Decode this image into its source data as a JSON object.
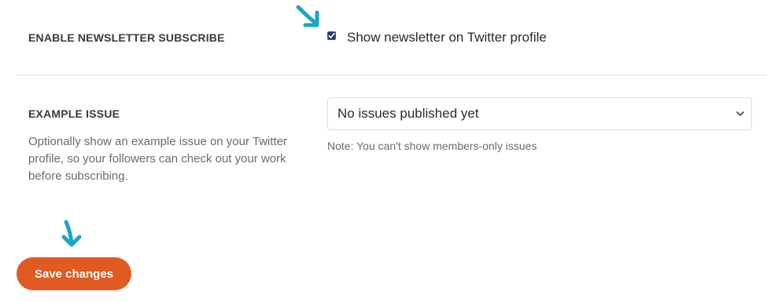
{
  "newsletter": {
    "label": "ENABLE NEWSLETTER SUBSCRIBE",
    "checkbox_label": "Show newsletter on Twitter profile",
    "checked": true
  },
  "example_issue": {
    "label": "EXAMPLE ISSUE",
    "help": "Optionally show an example issue on your Twitter profile, so your followers can check out your work before subscribing.",
    "selected": "No issues published yet",
    "note": "Note: You can't show members-only issues"
  },
  "actions": {
    "save_label": "Save changes"
  },
  "colors": {
    "accent": "#e05a21",
    "annotation_arrow": "#1aa6c8",
    "checkbox_fill": "#1d3d7a"
  },
  "icons": {
    "arrows": "annotation-arrow-icon",
    "select": "chevron-down-icon"
  }
}
